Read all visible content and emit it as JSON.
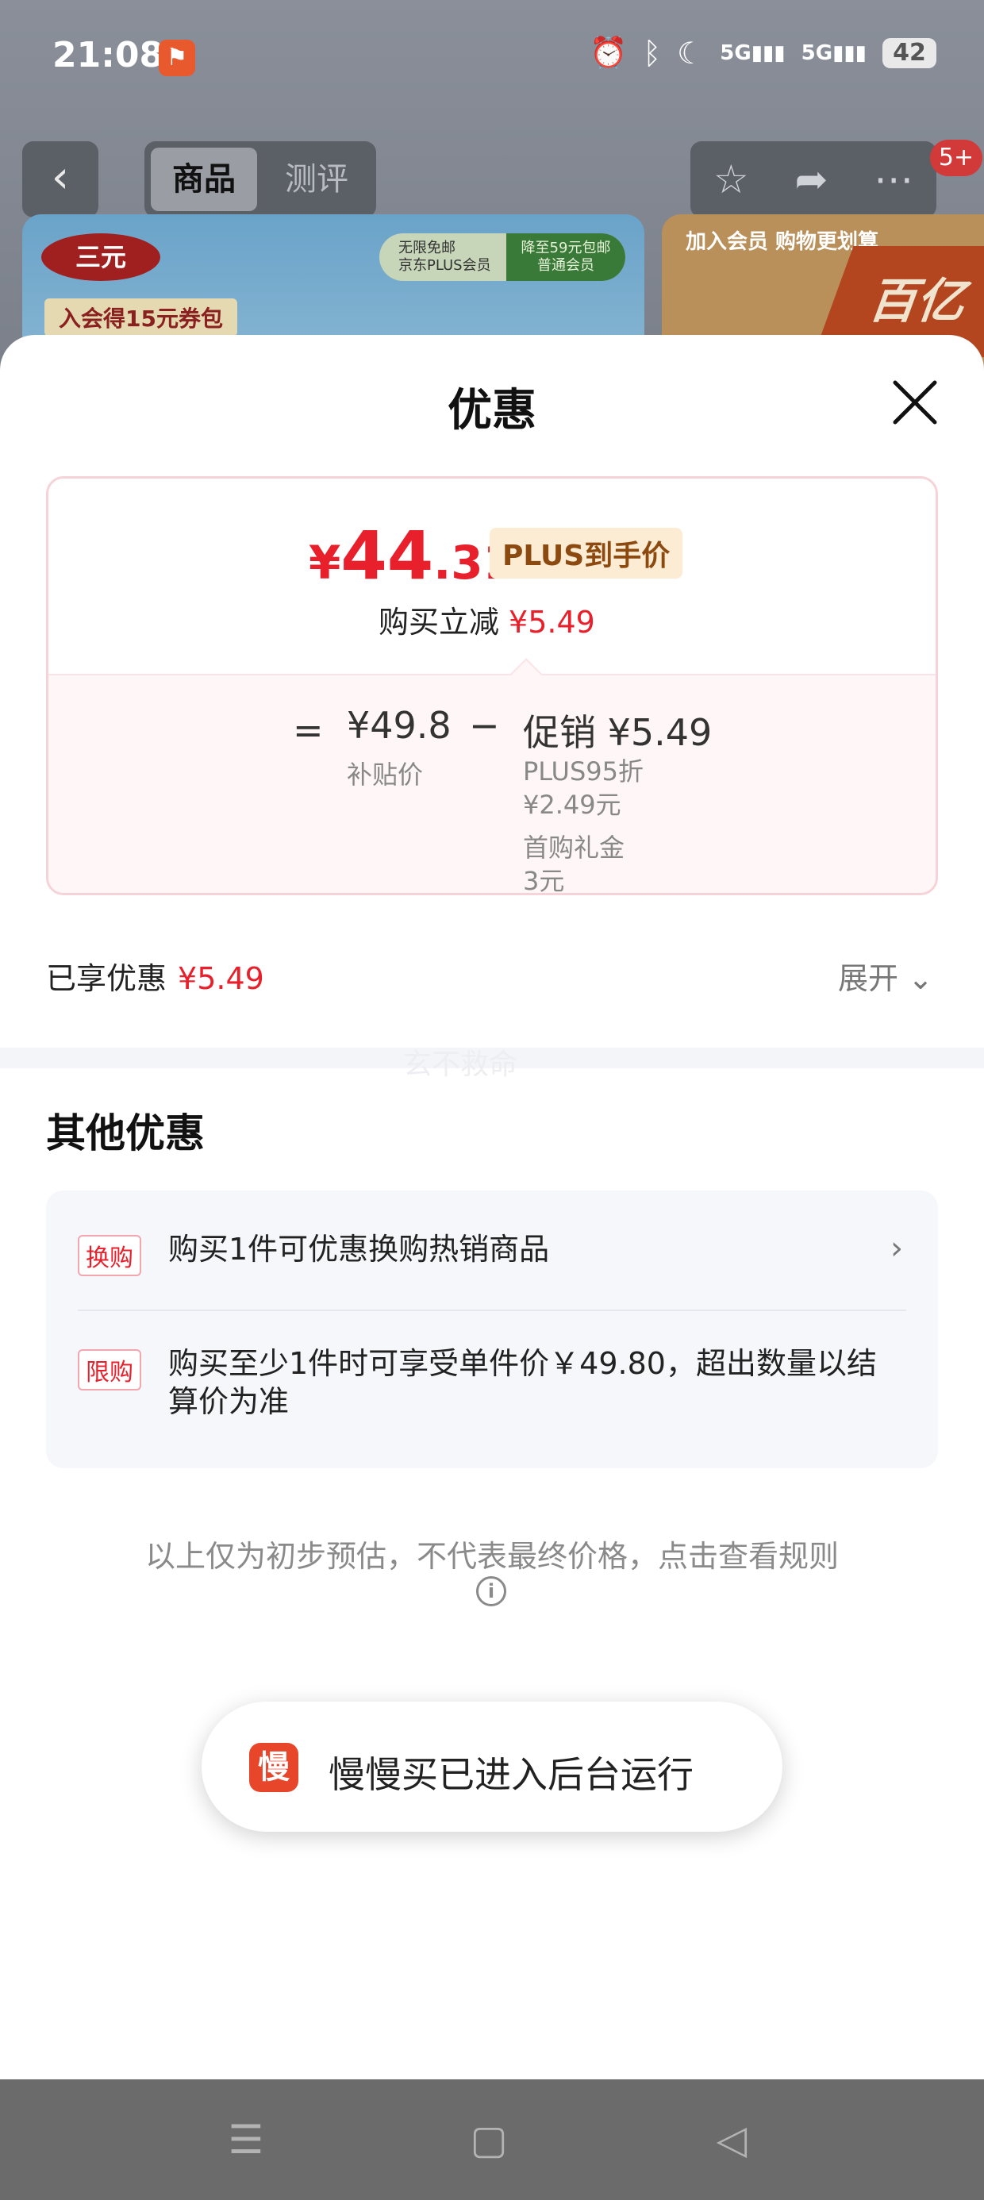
{
  "status_bar": {
    "time": "21:08",
    "app_icon": "person-run-icon",
    "battery": "42",
    "network_1": "5G",
    "network_2": "5G"
  },
  "header": {
    "tabs": [
      "商品",
      "测评"
    ],
    "message_count": "5+"
  },
  "banner": {
    "brand": "三元",
    "member_coupon": "入会得15元券包",
    "shipping_left": "无限免邮",
    "shipping_left_sub": "京东PLUS会员",
    "shipping_right": "降至59元包邮",
    "shipping_right_sub": "普通会员",
    "right_header": "加入会员 购物更划算",
    "right_text": "百亿"
  },
  "sheet": {
    "title": "优惠",
    "price": {
      "currency": "¥",
      "integer": "44",
      "decimal": ".31",
      "badge": "PLUS到手价",
      "reduce_label": "购买立减",
      "reduce_amount": "¥5.49"
    },
    "calc": {
      "equals": "=",
      "base_value": "¥49.8",
      "base_label": "补贴价",
      "minus": "−",
      "promo_label": "促销 ¥5.49",
      "details": [
        "PLUS95折",
        "¥2.49元",
        "首购礼金",
        "3元"
      ]
    },
    "enjoyed_label": "已享优惠",
    "enjoyed_amount": "¥5.49",
    "expand_label": "展开",
    "watermark": "玄不救命",
    "other_title": "其他优惠",
    "other_items": [
      {
        "tag": "换购",
        "text": "购买1件可优惠换购热销商品"
      },
      {
        "tag": "限购",
        "text": "购买至少1件时可享受单件价￥49.80，超出数量以结算价为准"
      }
    ],
    "disclaimer": "以上仅为初步预估，不代表最终价格，点击查看规则"
  },
  "toast": {
    "icon_char": "慢",
    "text": "慢慢买已进入后台运行"
  },
  "colors": {
    "accent_red": "#e8202c",
    "plus_badge_bg": "#fdecd4",
    "toast_icon": "#e8462a"
  }
}
